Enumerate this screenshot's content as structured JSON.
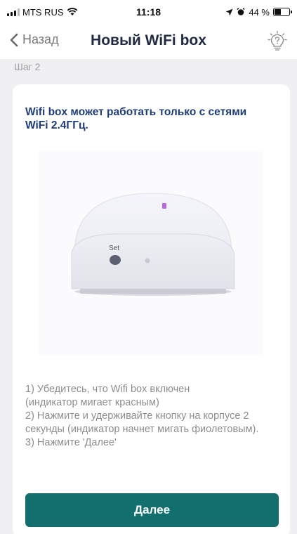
{
  "status_bar": {
    "carrier": "MTS RUS",
    "time": "11:18",
    "battery_text": "44 %",
    "battery_level": 0.44
  },
  "nav": {
    "back_label": "Назад",
    "title": "Новый WiFi box",
    "help_icon": "lightbulb-question-icon"
  },
  "step_label": "Шаг 2",
  "card": {
    "heading": "Wifi box может работать только с сетями WiFi 2.4ГГц.",
    "device_button_label": "Set",
    "instructions": [
      "1) Убедитесь, что Wifi box включен\n(индикатор мигает красным)",
      "2) Нажмите и удерживайте кнопку на корпусе 2 секунды (индикатор начнет мигать фиолетовым).",
      "3) Нажмите 'Далее'"
    ],
    "next_button": "Далее"
  },
  "colors": {
    "accent": "#136e6e",
    "heading": "#1f3d7a",
    "indicator": "#b86be0"
  }
}
